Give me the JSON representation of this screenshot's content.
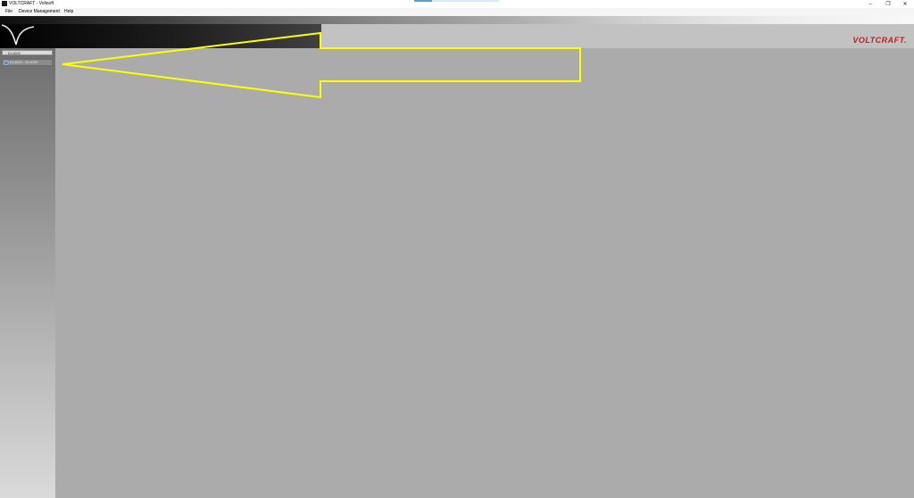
{
  "window": {
    "title": "VOLTCRAFT - Voltsoft",
    "controls": [
      "–",
      "❐",
      "✕"
    ]
  },
  "menu": {
    "items": [
      "File",
      "Device Management",
      "Help"
    ]
  },
  "banner": {
    "brand": "VOLTCRAFT.",
    "brand_color": "#d21a1a"
  },
  "sidebar": {
    "group_header": "EL4000",
    "device_item": "EL4000 - EL4000"
  },
  "annotation": {
    "arrow_color": "#ffff00"
  }
}
